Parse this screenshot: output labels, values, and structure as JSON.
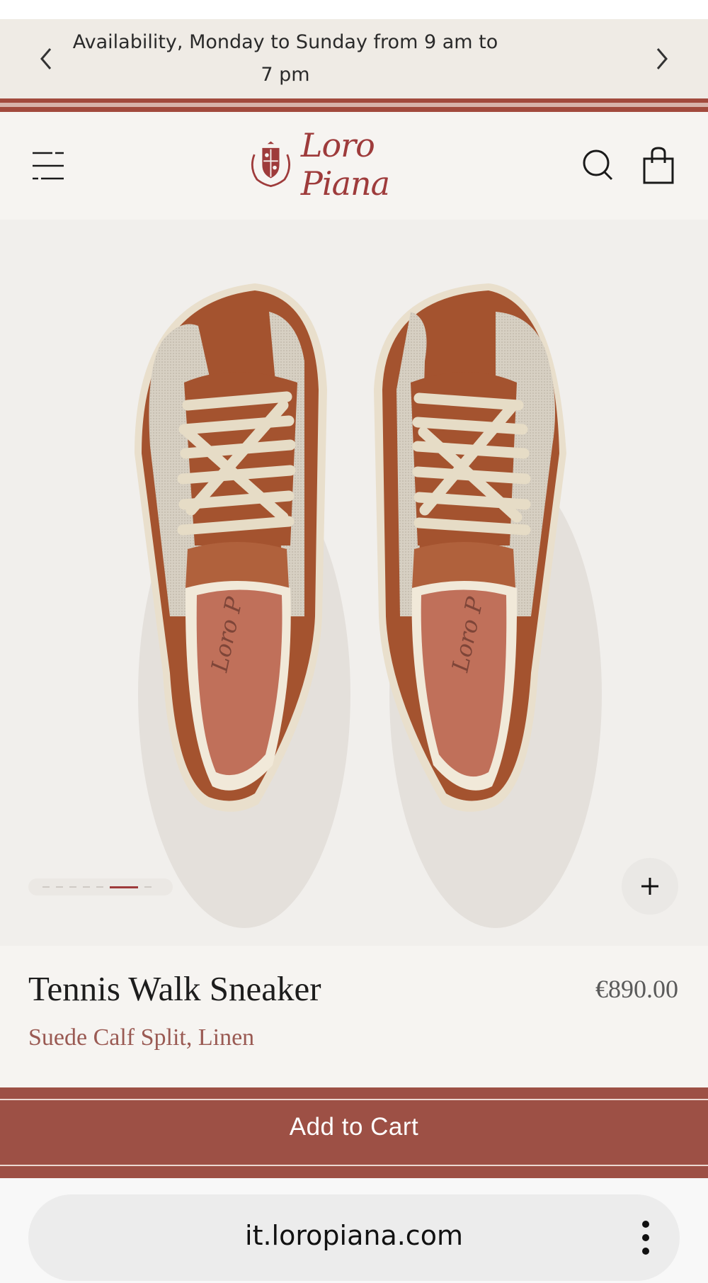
{
  "announcement": {
    "line1": "Availability, Monday to Sunday from 9 am to",
    "line2": "7 pm",
    "prev_icon": "chevron-left-icon",
    "next_icon": "chevron-right-icon"
  },
  "header": {
    "brand": "Loro Piana",
    "menu_icon": "hamburger-menu-icon",
    "search_icon": "search-icon",
    "bag_icon": "shopping-bag-icon"
  },
  "gallery": {
    "image_count": 7,
    "active_index": 5,
    "zoom_icon": "plus-icon"
  },
  "product": {
    "name": "Tennis Walk Sneaker",
    "material": "Suede Calf Split, Linen",
    "price": "€890.00"
  },
  "cart": {
    "label": "Add to Cart"
  },
  "browser": {
    "url": "it.loropiana.com",
    "menu_icon": "more-vertical-icon"
  },
  "colors": {
    "brand_red": "#9e3b3b",
    "cart_bg": "#9d5045",
    "announce_bg": "#efebe5",
    "leather": "#a4532f",
    "linen": "#d6cfc2"
  }
}
